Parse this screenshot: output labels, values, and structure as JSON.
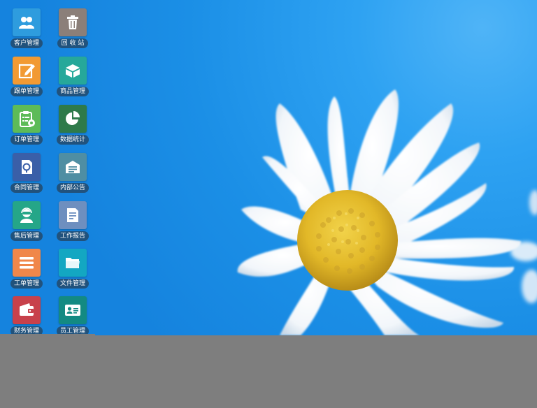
{
  "desktop": {
    "icons": [
      {
        "label": "客户管理",
        "icon": "customers-icon",
        "color": "#2e9cde"
      },
      {
        "label": "回 收 站",
        "icon": "trash-icon",
        "color": "#8b7f79"
      },
      {
        "label": "跟单管理",
        "icon": "edit-icon",
        "color": "#f29a33"
      },
      {
        "label": "商品管理",
        "icon": "box-icon",
        "color": "#26a89a"
      },
      {
        "label": "订单管理",
        "icon": "clipboard-icon",
        "color": "#5dbb58"
      },
      {
        "label": "数据统计",
        "icon": "pie-chart-icon",
        "color": "#2e7a4a"
      },
      {
        "label": "合同管理",
        "icon": "contract-icon",
        "color": "#3a5fa8"
      },
      {
        "label": "内部公告",
        "icon": "announcement-icon",
        "color": "#4f8ea3"
      },
      {
        "label": "售后管理",
        "icon": "support-agent-icon",
        "color": "#25a688"
      },
      {
        "label": "工作报告",
        "icon": "report-icon",
        "color": "#6e8fbf"
      },
      {
        "label": "工单管理",
        "icon": "list-icon",
        "color": "#f0874a"
      },
      {
        "label": "文件管理",
        "icon": "folder-icon",
        "color": "#13a7c2"
      },
      {
        "label": "财务管理",
        "icon": "wallet-icon",
        "color": "#c8414b"
      },
      {
        "label": "员工管理",
        "icon": "id-card-icon",
        "color": "#138a82"
      }
    ]
  },
  "taskbar": {
    "color": "#7e7e7e"
  }
}
